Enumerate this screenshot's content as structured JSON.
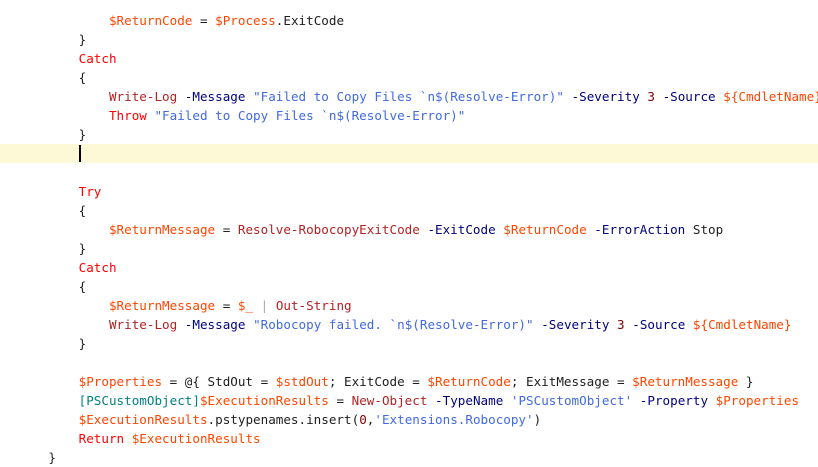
{
  "editor": {
    "lines": [
      {
        "indent": 12,
        "tokens": [
          [
            "var",
            "$ReturnCode"
          ],
          [
            "plain",
            " = "
          ],
          [
            "var",
            "$Process"
          ],
          [
            "plain",
            "."
          ],
          [
            "member",
            "ExitCode"
          ]
        ]
      },
      {
        "indent": 8,
        "tokens": [
          [
            "punc",
            "}"
          ]
        ]
      },
      {
        "indent": 8,
        "tokens": [
          [
            "kw",
            "Catch"
          ]
        ]
      },
      {
        "indent": 8,
        "tokens": [
          [
            "punc",
            "{"
          ]
        ]
      },
      {
        "indent": 12,
        "tokens": [
          [
            "cmd",
            "Write-Log"
          ],
          [
            "plain",
            " "
          ],
          [
            "param",
            "-Message"
          ],
          [
            "plain",
            " "
          ],
          [
            "str",
            "\"Failed to Copy Files `n$(Resolve-Error)\""
          ],
          [
            "plain",
            " "
          ],
          [
            "param",
            "-Severity"
          ],
          [
            "plain",
            " "
          ],
          [
            "num",
            "3"
          ],
          [
            "plain",
            " "
          ],
          [
            "param",
            "-Source"
          ],
          [
            "plain",
            " "
          ],
          [
            "var",
            "${CmdletName}"
          ]
        ]
      },
      {
        "indent": 12,
        "tokens": [
          [
            "kw",
            "Throw"
          ],
          [
            "plain",
            " "
          ],
          [
            "str",
            "\"Failed to Copy Files `n$(Resolve-Error)\""
          ]
        ]
      },
      {
        "indent": 8,
        "tokens": [
          [
            "punc",
            "}"
          ]
        ]
      },
      {
        "indent": 8,
        "tokens": [],
        "current": true,
        "caret": true
      },
      {
        "indent": 0,
        "tokens": []
      },
      {
        "indent": 8,
        "tokens": [
          [
            "kw",
            "Try"
          ]
        ]
      },
      {
        "indent": 8,
        "tokens": [
          [
            "punc",
            "{"
          ]
        ]
      },
      {
        "indent": 12,
        "tokens": [
          [
            "var",
            "$ReturnMessage"
          ],
          [
            "plain",
            " = "
          ],
          [
            "cmd",
            "Resolve-RobocopyExitCode"
          ],
          [
            "plain",
            " "
          ],
          [
            "param",
            "-ExitCode"
          ],
          [
            "plain",
            " "
          ],
          [
            "var",
            "$ReturnCode"
          ],
          [
            "plain",
            " "
          ],
          [
            "param",
            "-ErrorAction"
          ],
          [
            "plain",
            " Stop"
          ]
        ]
      },
      {
        "indent": 8,
        "tokens": [
          [
            "punc",
            "}"
          ]
        ]
      },
      {
        "indent": 8,
        "tokens": [
          [
            "kw",
            "Catch"
          ]
        ]
      },
      {
        "indent": 8,
        "tokens": [
          [
            "punc",
            "{"
          ]
        ]
      },
      {
        "indent": 12,
        "tokens": [
          [
            "var",
            "$ReturnMessage"
          ],
          [
            "plain",
            " = "
          ],
          [
            "var",
            "$_"
          ],
          [
            "plain",
            " "
          ],
          [
            "op",
            "|"
          ],
          [
            "plain",
            " "
          ],
          [
            "cmd",
            "Out-String"
          ]
        ]
      },
      {
        "indent": 12,
        "tokens": [
          [
            "cmd",
            "Write-Log"
          ],
          [
            "plain",
            " "
          ],
          [
            "param",
            "-Message"
          ],
          [
            "plain",
            " "
          ],
          [
            "str",
            "\"Robocopy failed. `n$(Resolve-Error)\""
          ],
          [
            "plain",
            " "
          ],
          [
            "param",
            "-Severity"
          ],
          [
            "plain",
            " "
          ],
          [
            "num",
            "3"
          ],
          [
            "plain",
            " "
          ],
          [
            "param",
            "-Source"
          ],
          [
            "plain",
            " "
          ],
          [
            "var",
            "${CmdletName}"
          ]
        ]
      },
      {
        "indent": 8,
        "tokens": [
          [
            "punc",
            "}"
          ]
        ]
      },
      {
        "indent": 0,
        "tokens": []
      },
      {
        "indent": 8,
        "tokens": [
          [
            "var",
            "$Properties"
          ],
          [
            "plain",
            " = @{ StdOut = "
          ],
          [
            "var",
            "$stdOut"
          ],
          [
            "plain",
            "; ExitCode = "
          ],
          [
            "var",
            "$ReturnCode"
          ],
          [
            "plain",
            "; ExitMessage = "
          ],
          [
            "var",
            "$ReturnMessage"
          ],
          [
            "plain",
            " }"
          ]
        ]
      },
      {
        "indent": 8,
        "tokens": [
          [
            "type",
            "[PSCustomObject]"
          ],
          [
            "var",
            "$ExecutionResults"
          ],
          [
            "plain",
            " = "
          ],
          [
            "cmd",
            "New-Object"
          ],
          [
            "plain",
            " "
          ],
          [
            "param",
            "-TypeName"
          ],
          [
            "plain",
            " "
          ],
          [
            "str",
            "'PSCustomObject'"
          ],
          [
            "plain",
            " "
          ],
          [
            "param",
            "-Property"
          ],
          [
            "plain",
            " "
          ],
          [
            "var",
            "$Properties"
          ]
        ]
      },
      {
        "indent": 8,
        "tokens": [
          [
            "var",
            "$ExecutionResults"
          ],
          [
            "plain",
            ".pstypenames.insert("
          ],
          [
            "num",
            "0"
          ],
          [
            "plain",
            ","
          ],
          [
            "str",
            "'Extensions.Robocopy'"
          ],
          [
            "plain",
            ")"
          ]
        ]
      },
      {
        "indent": 8,
        "tokens": [
          [
            "kw",
            "Return"
          ],
          [
            "plain",
            " "
          ],
          [
            "var",
            "$ExecutionResults"
          ]
        ]
      },
      {
        "indent": 4,
        "tokens": [
          [
            "punc",
            "}"
          ]
        ]
      }
    ]
  },
  "colors": {
    "variable": "#ff4500",
    "keyword": "#ff0000",
    "command": "#b22222",
    "parameter": "#000080",
    "string": "#4169e1",
    "number": "#800000",
    "current_line": "#fdf9d7"
  }
}
